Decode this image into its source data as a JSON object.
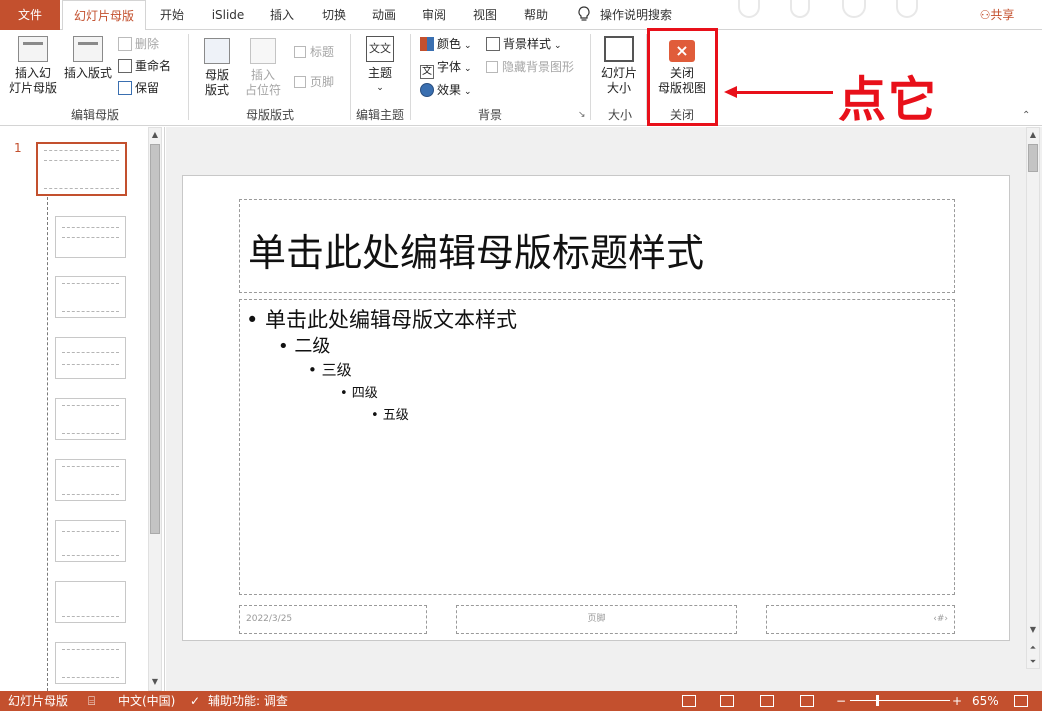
{
  "tabs": {
    "file": "文件",
    "items": [
      "幻灯片母版",
      "开始",
      "iSlide",
      "插入",
      "切换",
      "动画",
      "审阅",
      "视图",
      "帮助"
    ],
    "search": "操作说明搜索",
    "share": "共享"
  },
  "ribbon": {
    "edit_master": {
      "label": "编辑母版",
      "insert_master_l1": "插入幻",
      "insert_master_l2": "灯片母版",
      "insert_layout": "插入版式",
      "delete": "删除",
      "rename": "重命名",
      "preserve": "保留"
    },
    "master_layout": {
      "label": "母版版式",
      "master_layout_l1": "母版",
      "master_layout_l2": "版式",
      "insert_ph_l1": "插入",
      "insert_ph_l2": "占位符",
      "title_chk": "标题",
      "footer_chk": "页脚"
    },
    "edit_theme": {
      "label": "编辑主题",
      "theme": "主题"
    },
    "background": {
      "label": "背景",
      "colors": "颜色",
      "fonts": "字体",
      "effects": "效果",
      "bg_styles": "背景样式",
      "hide_bg": "隐藏背景图形"
    },
    "size": {
      "label": "大小",
      "slide_size_l1": "幻灯片",
      "slide_size_l2": "大小"
    },
    "close": {
      "label": "关闭",
      "close_l1": "关闭",
      "close_l2": "母版视图"
    }
  },
  "annotation": {
    "text": "点它"
  },
  "thumbnails": {
    "slide_number": "1",
    "count": 9
  },
  "slide": {
    "title": "单击此处编辑母版标题样式",
    "body": {
      "level1": "• 单击此处编辑母版文本样式",
      "level2": "• 二级",
      "level3": "• 三级",
      "level4": "• 四级",
      "level5": "• 五级"
    },
    "footer_date": "2022/3/25",
    "footer_text": "页脚",
    "footer_num": "‹#›"
  },
  "statusbar": {
    "view": "幻灯片母版",
    "language": "中文(中国)",
    "accessibility": "辅助功能: 调查",
    "zoom_minus": "−",
    "zoom_plus": "+",
    "zoom": "65%"
  },
  "colors": {
    "accent": "#c3502e",
    "highlight": "#e8101a"
  }
}
